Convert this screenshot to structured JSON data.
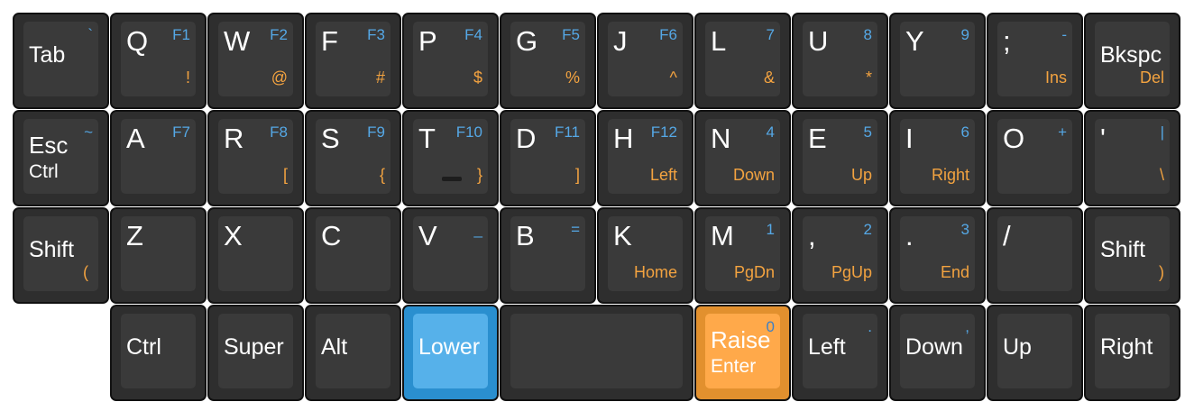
{
  "colors": {
    "key_fill": "#2e2e2e",
    "cap_fill": "#3a3a3a",
    "primary_legend": "#ffffff",
    "lower_layer_legend": "#55a8e6",
    "raise_layer_legend": "#f3a340",
    "lower_key": "#56b1ea",
    "raise_key": "#ffa94a"
  },
  "rows": [
    {
      "keys": [
        {
          "name": "tab",
          "main": "Tab",
          "tr": "`",
          "br": "",
          "style": "word"
        },
        {
          "name": "q",
          "main": "Q",
          "tr": "F1",
          "br": "!"
        },
        {
          "name": "w",
          "main": "W",
          "tr": "F2",
          "br": "@"
        },
        {
          "name": "f",
          "main": "F",
          "tr": "F3",
          "br": "#"
        },
        {
          "name": "p",
          "main": "P",
          "tr": "F4",
          "br": "$"
        },
        {
          "name": "g",
          "main": "G",
          "tr": "F5",
          "br": "%"
        },
        {
          "name": "j",
          "main": "J",
          "tr": "F6",
          "br": "^"
        },
        {
          "name": "l",
          "main": "L",
          "tr": "7",
          "br": "&"
        },
        {
          "name": "u",
          "main": "U",
          "tr": "8",
          "br": "*"
        },
        {
          "name": "y",
          "main": "Y",
          "tr": "9",
          "br": ""
        },
        {
          "name": "semicolon",
          "main": ";",
          "tr": "-",
          "br": "Ins"
        },
        {
          "name": "bkspc",
          "main": "Bkspc",
          "tr": "",
          "br": "Del",
          "style": "word"
        }
      ]
    },
    {
      "keys": [
        {
          "name": "esc",
          "main": "Esc",
          "sub": "Ctrl",
          "tr": "~",
          "br": "",
          "style": "two-line"
        },
        {
          "name": "a",
          "main": "A",
          "tr": "F7",
          "br": ""
        },
        {
          "name": "r",
          "main": "R",
          "tr": "F8",
          "br": "["
        },
        {
          "name": "s",
          "main": "S",
          "tr": "F9",
          "br": "{"
        },
        {
          "name": "t",
          "main": "T",
          "tr": "F10",
          "br": "}",
          "bump": true
        },
        {
          "name": "d",
          "main": "D",
          "tr": "F11",
          "br": "]"
        },
        {
          "name": "h",
          "main": "H",
          "tr": "F12",
          "br": "Left"
        },
        {
          "name": "n",
          "main": "N",
          "tr": "4",
          "br": "Down"
        },
        {
          "name": "e",
          "main": "E",
          "tr": "5",
          "br": "Up"
        },
        {
          "name": "i",
          "main": "I",
          "tr": "6",
          "br": "Right"
        },
        {
          "name": "o",
          "main": "O",
          "tr": "+",
          "br": ""
        },
        {
          "name": "quote",
          "main": "'",
          "tr": "|",
          "br": "\\"
        }
      ]
    },
    {
      "keys": [
        {
          "name": "shift-left",
          "main": "Shift",
          "tr": "",
          "bl": "(",
          "br": "",
          "style": "word"
        },
        {
          "name": "z",
          "main": "Z",
          "tr": "",
          "br": ""
        },
        {
          "name": "x",
          "main": "X",
          "tr": "",
          "br": ""
        },
        {
          "name": "c",
          "main": "C",
          "tr": "",
          "br": ""
        },
        {
          "name": "v",
          "main": "V",
          "tr": "_",
          "br": ""
        },
        {
          "name": "b",
          "main": "B",
          "tr": "=",
          "br": ""
        },
        {
          "name": "k",
          "main": "K",
          "tr": "",
          "br": "Home"
        },
        {
          "name": "m",
          "main": "M",
          "tr": "1",
          "br": "PgDn"
        },
        {
          "name": "comma",
          "main": ",",
          "tr": "2",
          "br": "PgUp"
        },
        {
          "name": "period",
          "main": ".",
          "tr": "3",
          "br": "End"
        },
        {
          "name": "slash",
          "main": "/",
          "tr": "",
          "br": ""
        },
        {
          "name": "shift-right",
          "main": "Shift",
          "tr": "",
          "br": ")",
          "style": "word"
        }
      ]
    },
    {
      "keys": [
        {
          "name": "ctrl",
          "main": "Ctrl",
          "tr": "",
          "br": "",
          "style": "word"
        },
        {
          "name": "super",
          "main": "Super",
          "tr": "",
          "br": "",
          "style": "word"
        },
        {
          "name": "alt",
          "main": "Alt",
          "tr": "",
          "br": "",
          "style": "word"
        },
        {
          "name": "lower",
          "main": "Lower",
          "tr": "",
          "br": "",
          "style": "word",
          "variant": "lower"
        },
        {
          "name": "space",
          "main": "",
          "tr": "",
          "br": "",
          "span": 2
        },
        {
          "name": "raise",
          "main": "Raise",
          "sub": "Enter",
          "tr": "0",
          "br": "",
          "style": "two-line",
          "variant": "raise"
        },
        {
          "name": "left",
          "main": "Left",
          "tr": ".",
          "br": "",
          "style": "word"
        },
        {
          "name": "down",
          "main": "Down",
          "tr": ",",
          "br": "",
          "style": "word"
        },
        {
          "name": "up",
          "main": "Up",
          "tr": "",
          "br": "",
          "style": "word"
        },
        {
          "name": "right",
          "main": "Right",
          "tr": "",
          "br": "",
          "style": "word"
        }
      ]
    }
  ]
}
